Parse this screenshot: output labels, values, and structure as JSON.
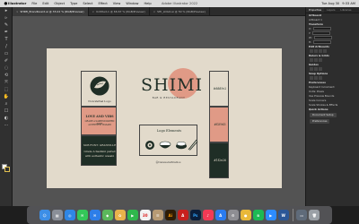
{
  "menubar": {
    "items": [
      "Illustrator",
      "File",
      "Edit",
      "Object",
      "Type",
      "Select",
      "Effect",
      "View",
      "Window",
      "Help"
    ],
    "doc_title": "Adobe Illustrator 2022",
    "status_items": [
      "Tue Aug 30",
      "9:33 AM"
    ]
  },
  "tabs": [
    {
      "label": "SHIMI_Brandboard.ai @ 33.22 % (RGB/Preview)",
      "active": true
    },
    {
      "label": "Untitled-1 @ 66.67 % (RGB/Preview)",
      "active": false
    },
    {
      "label": "SHI_LOGO.ai @ 50 % (RGB/Preview)",
      "active": false
    }
  ],
  "tools": [
    "▸",
    "▹",
    "✎",
    "✒",
    "T",
    "/",
    "▭",
    "✐",
    "◌",
    "⟲",
    "⤧",
    "⬚",
    "✋",
    "⌕",
    "☐",
    "◐",
    "⋯"
  ],
  "artboard": {
    "secondary_logo": {
      "caption": "Non-Verbal Logo",
      "colors": {
        "circle": "#1f2e26"
      }
    },
    "type_top": {
      "title": "LOVE AND VIBS",
      "line1": "GRADE A SASHIMI PAIRED WITH",
      "line2": "AUTHENTIC WASABI"
    },
    "type_bottom": {
      "title": "SUB FONT: GRANVILLE",
      "line1": "Grade A Sashimi paired",
      "line2": "with authentic wasabi"
    },
    "brand": {
      "name": "SHIMI",
      "tagline": "BAR & RESTAURANT",
      "circle_color": "#e09a86"
    },
    "logo_elements_title": "Logo Elements",
    "social": "@CanaveralStudios",
    "swatches": [
      {
        "hex": "#ddd9c2",
        "color": "#e2dacb"
      },
      {
        "hex": "#f2f9d3",
        "color": "#e09a86"
      },
      {
        "hex": "#1f2e26",
        "color": "#1f2e26"
      }
    ]
  },
  "panel": {
    "tabs": [
      "Properties",
      "Layers",
      "Libraries"
    ],
    "sections": [
      {
        "head": "Artboard",
        "rows": [
          "Artboard 1"
        ]
      },
      {
        "head": "Transform",
        "rows": [
          "X:",
          "Y:",
          "W:",
          "H:"
        ]
      },
      {
        "head": "Edit Artboards",
        "rows": []
      },
      {
        "head": "Rulers & Grids",
        "rows": []
      },
      {
        "head": "Guides",
        "rows": []
      },
      {
        "head": "Snap Options",
        "rows": []
      },
      {
        "head": "Preferences",
        "rows": [
          "Keyboard Increment:",
          "Units: Pixels",
          "Use Preview Bounds",
          "Scale Corners",
          "Scale Strokes & Effects"
        ]
      },
      {
        "head": "Quick Actions",
        "rows": []
      }
    ],
    "buttons": {
      "doc_setup": "Document Setup",
      "preferences": "Preferences"
    }
  },
  "dock": {
    "icons": [
      {
        "name": "finder",
        "label": "☺",
        "color": "#3d8ee6"
      },
      {
        "name": "launchpad",
        "label": "▦",
        "color": "#8a8f98"
      },
      {
        "name": "safari",
        "label": "◎",
        "color": "#2f86e4"
      },
      {
        "name": "messages",
        "label": "✉",
        "color": "#34c759"
      },
      {
        "name": "mail",
        "label": "✉",
        "color": "#2d7ee8"
      },
      {
        "name": "maps",
        "label": "◆",
        "color": "#5bb75b"
      },
      {
        "name": "photos",
        "label": "✿",
        "color": "#e8b34b"
      },
      {
        "name": "facetime",
        "label": "▶",
        "color": "#2fb84c"
      },
      {
        "name": "calendar",
        "label": "30",
        "color": "#f2f2f2"
      },
      {
        "name": "contacts",
        "label": "☰",
        "color": "#b79a74"
      },
      {
        "name": "illustrator",
        "label": "Ai",
        "color": "#2e1c06"
      },
      {
        "name": "acrobat",
        "label": "A",
        "color": "#c8201e"
      },
      {
        "name": "photoshop",
        "label": "Ps",
        "color": "#0b1e3a"
      },
      {
        "name": "music",
        "label": "♪",
        "color": "#f23a55"
      },
      {
        "name": "app-store",
        "label": "A",
        "color": "#2a7cf0"
      },
      {
        "name": "settings",
        "label": "⚙",
        "color": "#8e8e93"
      },
      {
        "name": "chrome",
        "label": "●",
        "color": "#e9b83a"
      },
      {
        "name": "spotify",
        "label": "≋",
        "color": "#1db954"
      },
      {
        "name": "zoom",
        "label": "▶",
        "color": "#2d8cff"
      },
      {
        "name": "word",
        "label": "W",
        "color": "#2b5797"
      },
      {
        "name": "finder-window",
        "label": "▭",
        "color": "#5f6b7a"
      },
      {
        "name": "trash",
        "label": "🗑",
        "color": "#9aa0a6"
      }
    ]
  }
}
